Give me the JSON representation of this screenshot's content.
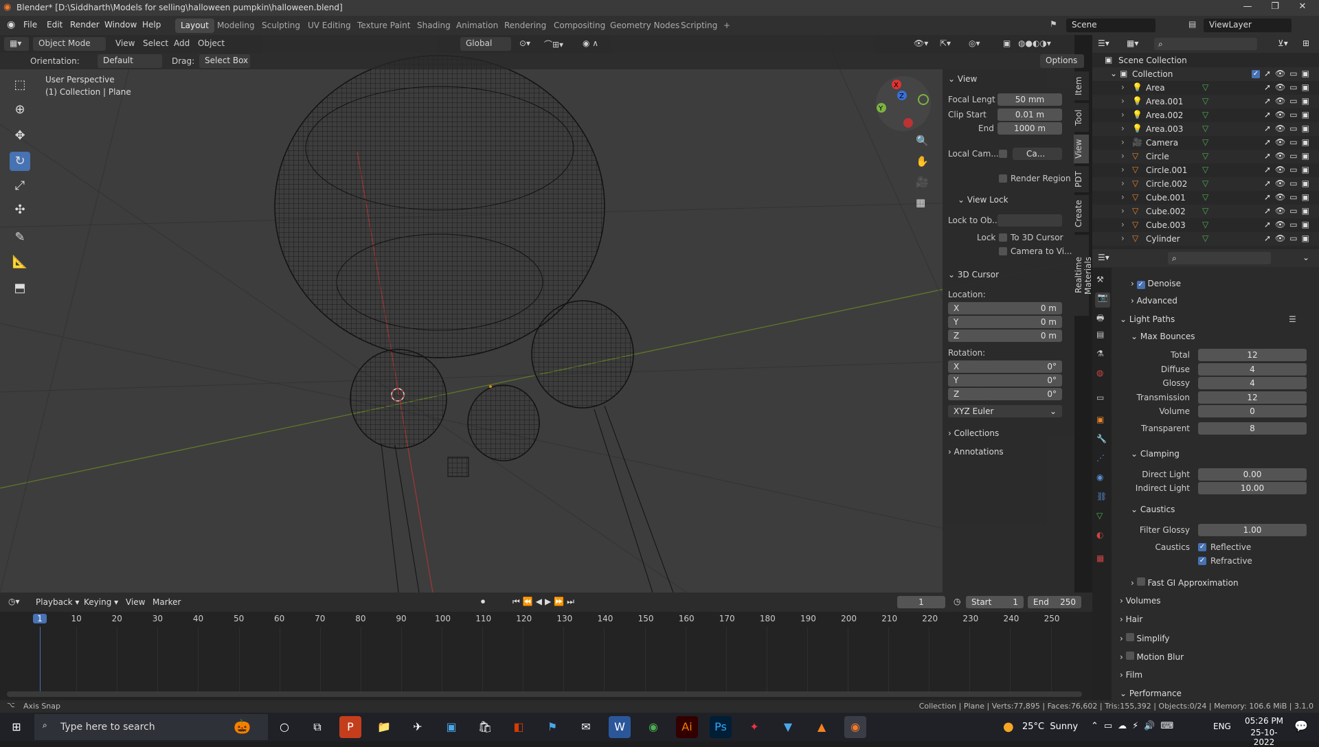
{
  "window": {
    "title": "Blender* [D:\\Siddharth\\Models for selling\\halloween pumpkin\\halloween.blend]",
    "min": "—",
    "max": "❐",
    "close": "✕"
  },
  "menu": [
    "File",
    "Edit",
    "Render",
    "Window",
    "Help"
  ],
  "workspaces": [
    "Layout",
    "Modeling",
    "Sculpting",
    "UV Editing",
    "Texture Paint",
    "Shading",
    "Animation",
    "Rendering",
    "Compositing",
    "Geometry Nodes",
    "Scripting",
    "+"
  ],
  "scene": {
    "label": "Scene",
    "viewlayer": "ViewLayer"
  },
  "viewport_header": {
    "mode": "Object Mode",
    "view": "View",
    "select": "Select",
    "add": "Add",
    "object": "Object",
    "transform": "Global"
  },
  "viewport_header2": {
    "orientation_label": "Orientation:",
    "orientation": "Default",
    "drag_label": "Drag:",
    "drag": "Select Box",
    "options": "Options"
  },
  "viewport_info": {
    "line1": "User Perspective",
    "line2": "(1) Collection | Plane"
  },
  "npanel": {
    "view_title": "View",
    "focal_label": "Focal Lengt",
    "focal": "50 mm",
    "clip_start_label": "Clip Start",
    "clip_start": "0.01 m",
    "end_label": "End",
    "end": "1000 m",
    "local_cam_label": "Local Cam...",
    "local_cam": "Ca...",
    "render_region": "Render Region",
    "view_lock_title": "View Lock",
    "lock_obj_label": "Lock to Ob...",
    "lock_label": "Lock",
    "lock_cursor": "To 3D Cursor",
    "lock_camera": "Camera to Vi...",
    "cursor_title": "3D Cursor",
    "location_label": "Location:",
    "rotation_label": "Rotation:",
    "x": "X",
    "y": "Y",
    "z": "Z",
    "loc": [
      "0 m",
      "0 m",
      "0 m"
    ],
    "rot": [
      "0°",
      "0°",
      "0°"
    ],
    "euler": "XYZ Euler",
    "collections": "Collections",
    "annotations": "Annotations"
  },
  "vtabs": [
    "Item",
    "Tool",
    "View",
    "PDT",
    "Create",
    "Realtime Materials"
  ],
  "outliner": {
    "root": "Scene Collection",
    "collection": "Collection",
    "items": [
      "Area",
      "Area.001",
      "Area.002",
      "Area.003",
      "Camera",
      "Circle",
      "Circle.001",
      "Circle.002",
      "Cube.001",
      "Cube.002",
      "Cube.003",
      "Cylinder"
    ]
  },
  "props": {
    "denoise": "Denoise",
    "advanced": "Advanced",
    "light_paths": "Light Paths",
    "max_bounces": "Max Bounces",
    "bounces": [
      {
        "label": "Total",
        "value": "12"
      },
      {
        "label": "Diffuse",
        "value": "4"
      },
      {
        "label": "Glossy",
        "value": "4"
      },
      {
        "label": "Transmission",
        "value": "12"
      },
      {
        "label": "Volume",
        "value": "0"
      },
      {
        "label": "Transparent",
        "value": "8"
      }
    ],
    "clamping": "Clamping",
    "direct_label": "Direct Light",
    "direct": "0.00",
    "indirect_label": "Indirect Light",
    "indirect": "10.00",
    "caustics": "Caustics",
    "filter_glossy_label": "Filter Glossy",
    "filter_glossy": "1.00",
    "caustics_label": "Caustics",
    "reflective": "Reflective",
    "refractive": "Refractive",
    "fast_gi": "Fast GI Approximation",
    "volumes": "Volumes",
    "hair": "Hair",
    "simplify": "Simplify",
    "motion_blur": "Motion Blur",
    "film": "Film",
    "performance": "Performance"
  },
  "timeline": {
    "playback": "Playback",
    "keying": "Keying",
    "view": "View",
    "marker": "Marker",
    "current": "1",
    "start_label": "Start",
    "start": "1",
    "end_label": "End",
    "end": "250",
    "ticks": [
      "1",
      "10",
      "20",
      "30",
      "40",
      "50",
      "60",
      "70",
      "80",
      "90",
      "100",
      "110",
      "120",
      "130",
      "140",
      "150",
      "160",
      "170",
      "180",
      "190",
      "200",
      "210",
      "220",
      "230",
      "240",
      "250"
    ]
  },
  "status": {
    "left": "Axis Snap",
    "right": "Collection | Plane | Verts:77,895 | Faces:76,602 | Tris:155,392 | Objects:0/24 | Memory: 106.6 MiB | 3.1.0"
  },
  "taskbar": {
    "search": "Type here to search",
    "weather": "25°C  Sunny",
    "lang": "ENG",
    "time": "05:26 PM",
    "date": "25-10-2022"
  }
}
